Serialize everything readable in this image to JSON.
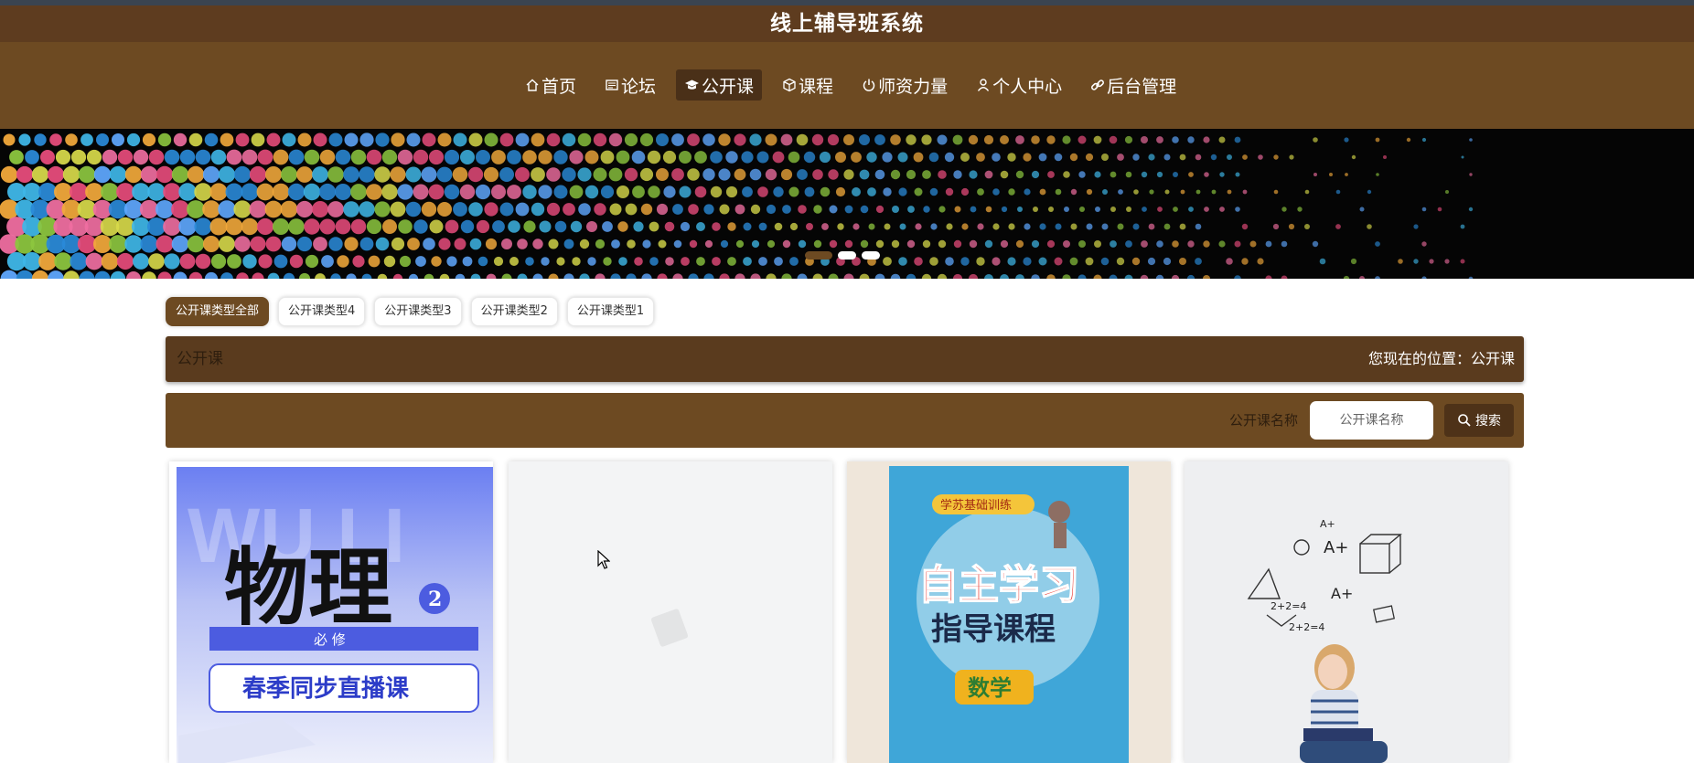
{
  "app": {
    "title": "线上辅导班系统"
  },
  "nav": {
    "items": [
      {
        "label": "首页",
        "icon": "home-icon"
      },
      {
        "label": "论坛",
        "icon": "forum-icon"
      },
      {
        "label": "公开课",
        "icon": "graduation-cap-icon"
      },
      {
        "label": "课程",
        "icon": "cube-icon"
      },
      {
        "label": "师资力量",
        "icon": "power-icon"
      },
      {
        "label": "个人中心",
        "icon": "user-icon"
      },
      {
        "label": "后台管理",
        "icon": "link-icon"
      }
    ],
    "active": "公开课"
  },
  "banner": {
    "slides": 3,
    "active_slide": 1
  },
  "filters": {
    "chips": [
      "公开课类型全部",
      "公开课类型4",
      "公开课类型3",
      "公开课类型2",
      "公开课类型1"
    ],
    "active": "公开课类型全部"
  },
  "breadcrumb": {
    "title": "公开课",
    "location": "您现在的位置：公开课"
  },
  "search": {
    "label": "公开课名称",
    "placeholder": "公开课名称",
    "value": "",
    "button_label": "搜索"
  },
  "cards": [
    {
      "big": "物理",
      "watermark": "WU LI",
      "badge": "2",
      "strip": "必 修",
      "caption": "春季同步直播课"
    },
    {},
    {
      "top": "学苏基础训练",
      "title": "自主学习",
      "subtitle": "指导课程",
      "tag": "数学"
    },
    {
      "doodles": [
        "A+",
        "A+",
        "2+2=4",
        "2+2=4",
        "A+"
      ]
    }
  ],
  "colors": {
    "brown_dark": "#5e3c1f",
    "brown": "#6d4a22",
    "brown_deep": "#4e3218",
    "physics_blue": "#5a6ef0",
    "book_blue": "#3fa6d8",
    "book_red": "#e8231a"
  }
}
